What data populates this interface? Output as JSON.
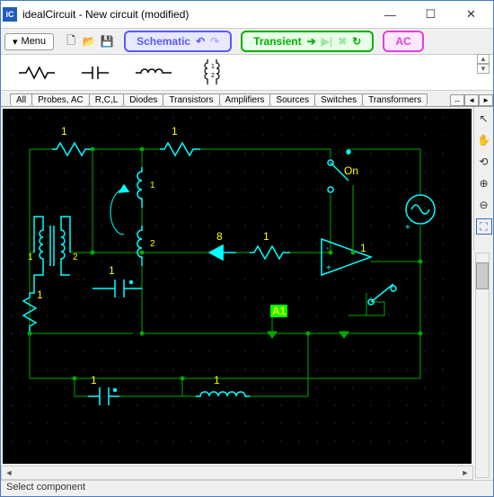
{
  "app": {
    "icon_text": "iC",
    "title": "idealCircuit - New circuit (modified)"
  },
  "win": {
    "min": "—",
    "max": "☐",
    "close": "✕"
  },
  "menu": {
    "label": "Menu",
    "arrow": "▾"
  },
  "file_icons": {
    "new": "🗋",
    "open": "📂",
    "save": "💾"
  },
  "tabs": {
    "schematic": {
      "label": "Schematic",
      "undo": "↶",
      "redo": "↷"
    },
    "transient": {
      "label": "Transient"
    },
    "ac": {
      "label": "AC"
    }
  },
  "categories": [
    "All",
    "Probes, AC",
    "R,C,L",
    "Diodes",
    "Transistors",
    "Amplifiers",
    "Sources",
    "Switches",
    "Transformers"
  ],
  "nav": {
    "prev": "◄",
    "next": "►",
    "expand": "↔"
  },
  "side": {
    "arrow": "↖",
    "hand": "✋",
    "pan": "⟲",
    "zin": "⊕",
    "zout": "⊖",
    "fit": "⛶"
  },
  "labels": {
    "l1": "1",
    "l2": "1",
    "on": "On",
    "l8": "8",
    "l3": "1",
    "ly": "1",
    "lx1": "1",
    "lx2": "2",
    "lc": "1",
    "la": "1",
    "lb": "1",
    "a1": "A1",
    "lt": "1"
  },
  "status": "Select component"
}
